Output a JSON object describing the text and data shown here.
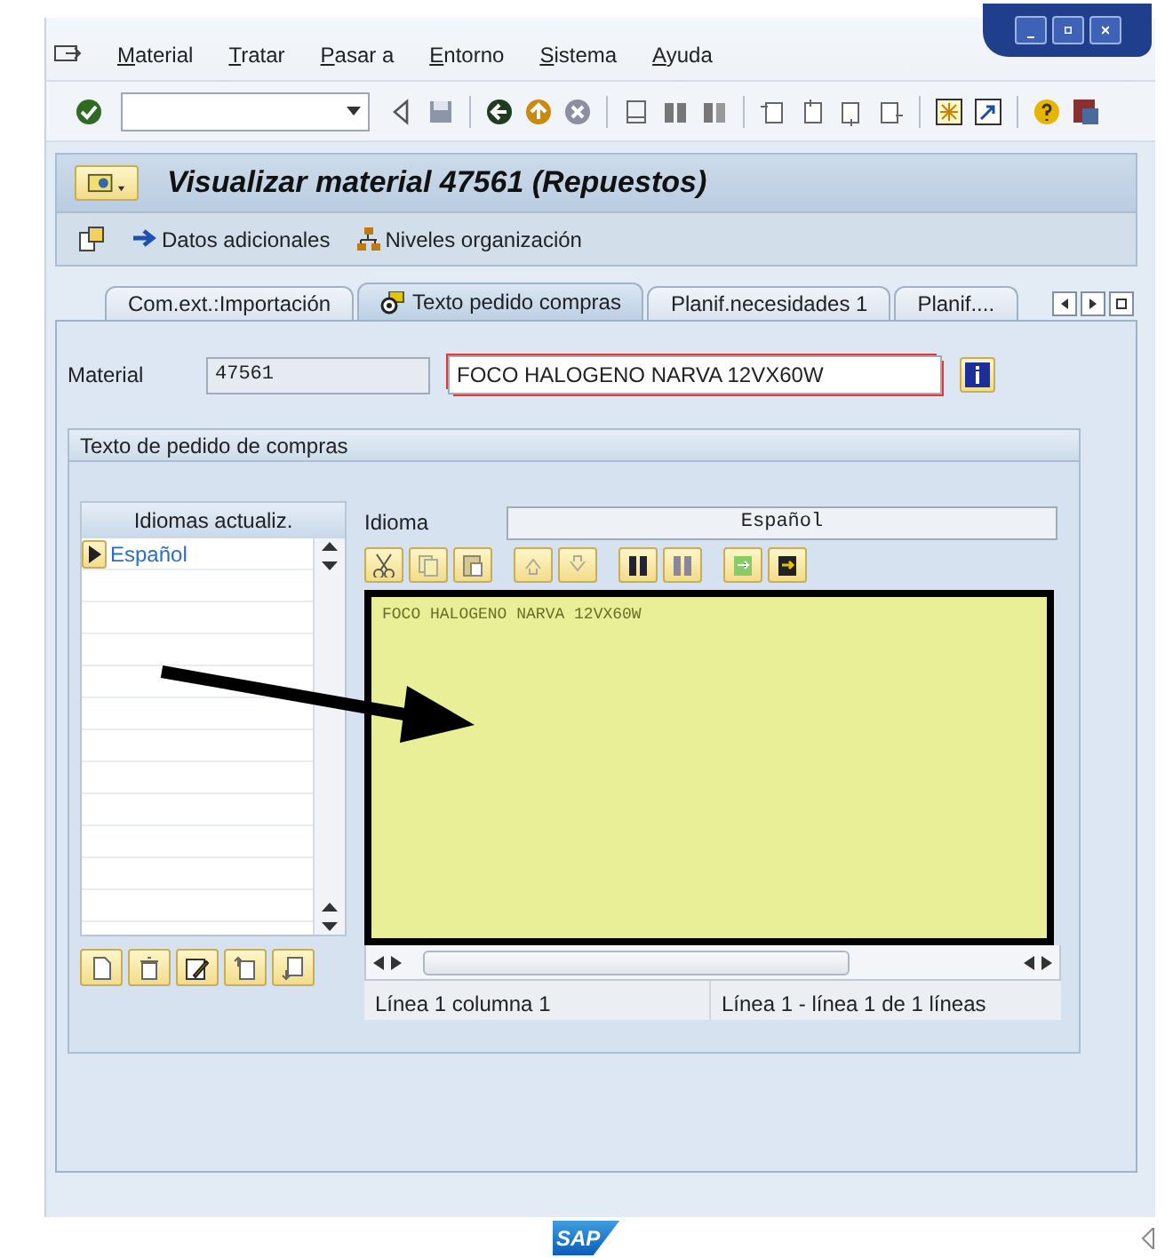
{
  "menu_bar": {
    "items": [
      "Material",
      "Tratar",
      "Pasar a",
      "Entorno",
      "Sistema",
      "Ayuda"
    ]
  },
  "title": "Visualizar material 47561 (Repuestos)",
  "actions": [
    "Datos adicionales",
    "Niveles organización"
  ],
  "tabs": [
    {
      "label": "Com.ext.:Importación",
      "selected": false
    },
    {
      "label": "Texto pedido compras",
      "selected": true
    },
    {
      "label": "Planif.necesidades 1",
      "selected": false
    },
    {
      "label": "Planif....",
      "selected": false
    }
  ],
  "material": {
    "label": "Material",
    "number": "47561",
    "description": "FOCO HALOGENO NARVA 12VX60W"
  },
  "text_group": {
    "title": "Texto de pedido de compras",
    "languages_header": "Idiomas actualiz.",
    "languages": [
      {
        "label": "Español",
        "selected": true
      }
    ],
    "language_label": "Idioma",
    "language_value": "Español",
    "editor_text": "FOCO HALOGENO NARVA 12VX60W",
    "status_position": "Línea 1 columna 1",
    "status_lines": "Línea 1 - línea 1 de 1 líneas"
  },
  "logo_text": "SAP"
}
